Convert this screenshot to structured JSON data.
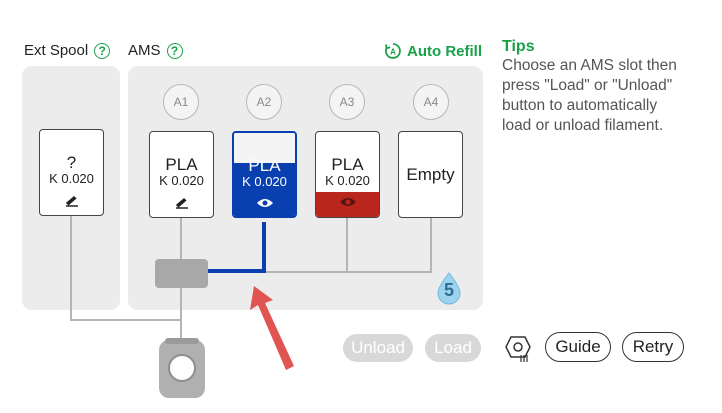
{
  "ext_spool": {
    "label": "Ext Spool",
    "help": "?",
    "name": "?",
    "k": "K 0.020"
  },
  "ams": {
    "label": "AMS",
    "help": "?",
    "auto_refill": "Auto Refill",
    "slots": [
      {
        "id": "A1",
        "material": "PLA",
        "k": "K 0.020",
        "color": "#ffffff",
        "state": "edit"
      },
      {
        "id": "A2",
        "material": "PLA",
        "k": "K 0.020",
        "color": "#0a3fb0",
        "state": "active"
      },
      {
        "id": "A3",
        "material": "PLA",
        "k": "K 0.020",
        "color": "#b8261e",
        "state": "view"
      },
      {
        "id": "A4",
        "material": "Empty",
        "k": "",
        "color": "#ffffff",
        "state": "empty"
      }
    ],
    "humidity_level": "5"
  },
  "tips": {
    "title": "Tips",
    "lines": [
      "Choose an AMS slot then",
      "press \"Load\" or \"Unload\"",
      "button to automatically",
      "load or unload filament."
    ]
  },
  "buttons": {
    "unload": "Unload",
    "load": "Load",
    "guide": "Guide",
    "retry": "Retry"
  },
  "colors": {
    "accent_green": "#1aa14a",
    "active_path": "#0a3fb0",
    "annotation_arrow": "#e05552"
  },
  "icons": {
    "slot_refresh": "rotate-arrow-icon",
    "edit": "pencil-icon",
    "view": "eye-icon",
    "humidity": "water-drop-icon",
    "settings": "nozzle-gear-icon",
    "auto_refill": "auto-refill-icon"
  }
}
